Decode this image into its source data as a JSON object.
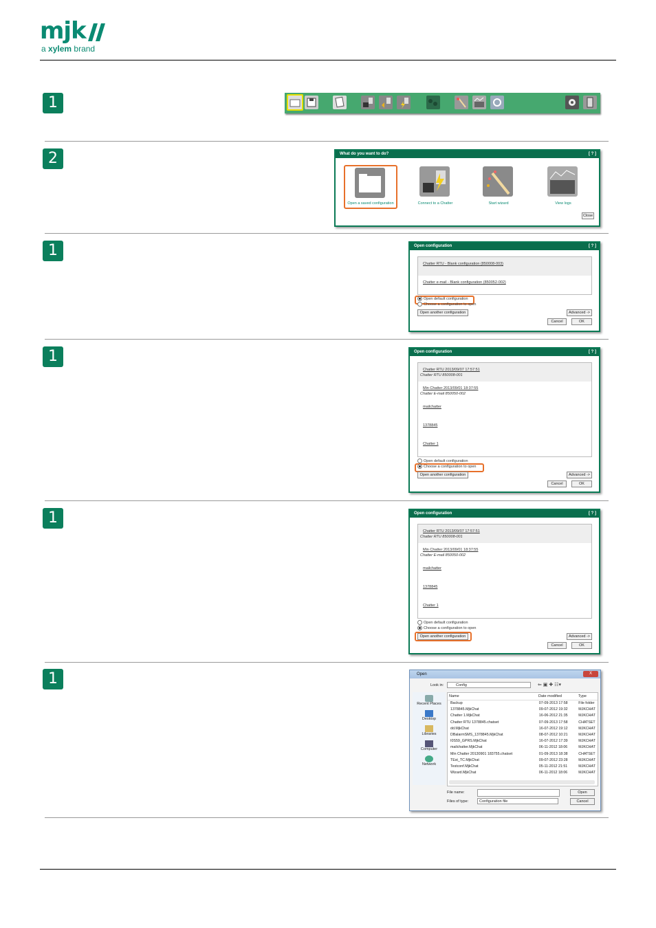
{
  "logo": {
    "name": "mjk",
    "tagline_prefix": "a",
    "tagline_brand": "xylem",
    "tagline_suffix": "brand"
  },
  "steps": [
    "1",
    "2",
    "1",
    "1",
    "1",
    "1"
  ],
  "dialog_start": {
    "title": "What do you want to do?",
    "help": "[ ? ]",
    "options": [
      "Open a saved configuration",
      "Connect to a Chatter",
      "Start wizard",
      "View logs"
    ],
    "close": "Close"
  },
  "open_config": {
    "title": "Open configuration",
    "help": "[ ? ]",
    "blank_items": [
      "Chatter RTU - Blank configuration (850008-003)",
      "Chatter e-mail - Blank configuration (850052-002)"
    ],
    "saved_items": [
      {
        "name": "Chatter RTU 2013/09/07 17:57:51",
        "sub": "Chatter RTU 850008-001"
      },
      {
        "name": "Min Chatter 2013/09/01 18:37:55",
        "sub": "Chatter E-mail 850050-002"
      },
      {
        "name": "mailchatter",
        "sub": ""
      },
      {
        "name": "1378845",
        "sub": ""
      },
      {
        "name": "Chatter 1",
        "sub": ""
      }
    ],
    "radio_default": "Open default configuration",
    "radio_choose": "Choose a configuration to open",
    "open_another": "Open another configuration",
    "advanced": "Advanced ->",
    "cancel": "Cancel",
    "ok": "OK"
  },
  "file_dialog": {
    "title": "Open",
    "close": "X",
    "look_in_label": "Look in:",
    "look_in_value": "Config",
    "places": [
      "Recent Places",
      "Desktop",
      "Libraries",
      "Computer",
      "Network"
    ],
    "columns": [
      "Name",
      "Date modified",
      "Type"
    ],
    "files": [
      [
        "Backup",
        "07-09-2013 17:58",
        "File folder"
      ],
      [
        "1378845.MjkChat",
        "09-07-2012 19:32",
        "MJKCHAT"
      ],
      [
        "Chatter 1.MjkChat",
        "16-06-2012 21:35",
        "MJKCHAT"
      ],
      [
        "Chatter RTU 1378845.chatset",
        "07-09-2013 17:58",
        "CHATSET"
      ],
      [
        "dd.MjkChat",
        "16-07-2012 19:12",
        "MJKCHAT"
      ],
      [
        "DBalarmSMS_1378845.MjkChat",
        "08-07-2012 10:21",
        "MJKCHAT"
      ],
      [
        "I0S59_GPRS.MjkChat",
        "16-07-2012 17:39",
        "MJKCHAT"
      ],
      [
        "mailchatter.MjkChat",
        "06-11-2012 18:06",
        "MJKCHAT"
      ],
      [
        "Min Chatter 20130901 183755.chatset",
        "01-09-2013 18:38",
        "CHATSET"
      ],
      [
        "TEst_TC.MjkChat",
        "09-07-2012 23:28",
        "MJKCHAT"
      ],
      [
        "Testconf.MjkChat",
        "05-11-2012 21:51",
        "MJKCHAT"
      ],
      [
        "Wizard.MjkChat",
        "06-11-2012 18:06",
        "MJKCHAT"
      ]
    ],
    "file_name_label": "File name:",
    "file_type_label": "Files of type:",
    "file_type_value": "Configuration file",
    "open": "Open",
    "cancel": "Cancel"
  },
  "colors": {
    "brand": "#0a8a72",
    "accent": "#e7702a",
    "dialog": "#0a6e4d",
    "toolbar": "#46a86f"
  },
  "toolbar_icons": [
    "open-folder-icon",
    "save-icon",
    "properties-icon",
    "chatter-connect-icon",
    "chatter-read-icon",
    "chatter-write-icon",
    "network-icon",
    "wizard-icon",
    "logs-icon",
    "refresh-icon",
    "settings-icon",
    "phone-icon"
  ]
}
